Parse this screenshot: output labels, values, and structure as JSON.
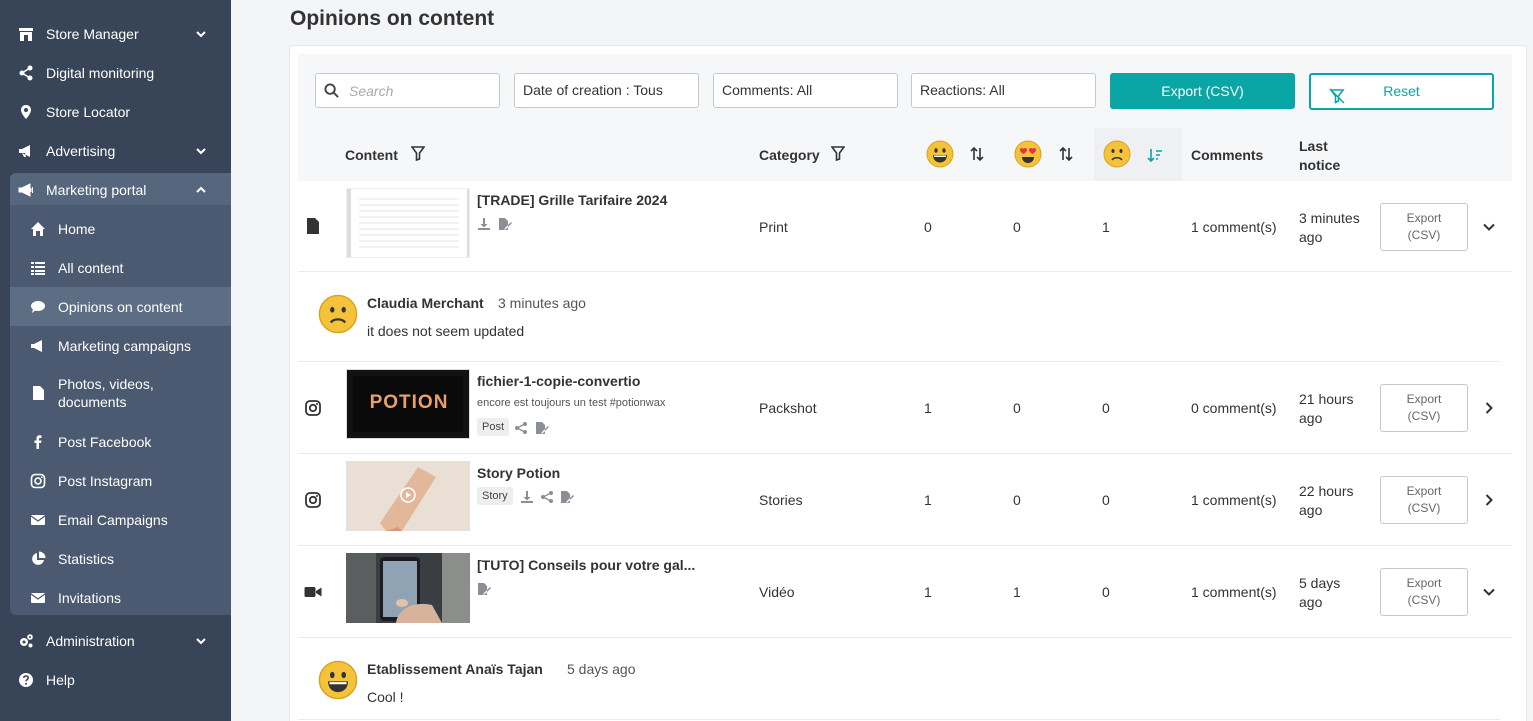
{
  "sidebar": {
    "items": [
      {
        "label": "Store Manager",
        "icon": "store-icon"
      },
      {
        "label": "Digital monitoring",
        "icon": "share-icon"
      },
      {
        "label": "Store Locator",
        "icon": "map-pin-icon"
      },
      {
        "label": "Advertising",
        "icon": "megaphone-icon"
      },
      {
        "label": "Marketing portal",
        "icon": "megaphone-icon"
      },
      {
        "label": "Administration",
        "icon": "gears-icon"
      },
      {
        "label": "Help",
        "icon": "help-icon"
      }
    ],
    "submenu": [
      {
        "label": "Home",
        "icon": "home-icon"
      },
      {
        "label": "All content",
        "icon": "list-icon"
      },
      {
        "label": "Opinions on content",
        "icon": "comment-icon"
      },
      {
        "label": "Marketing campaigns",
        "icon": "megaphone-icon"
      },
      {
        "label": "Photos, videos, documents",
        "icon": "file-icon"
      },
      {
        "label": "Post Facebook",
        "icon": "facebook-icon"
      },
      {
        "label": "Post Instagram",
        "icon": "instagram-icon"
      },
      {
        "label": "Email Campaigns",
        "icon": "envelope-icon"
      },
      {
        "label": "Statistics",
        "icon": "pie-chart-icon"
      },
      {
        "label": "Invitations",
        "icon": "envelope-icon"
      }
    ]
  },
  "page": {
    "title": "Opinions on content"
  },
  "filters": {
    "search_placeholder": "Search",
    "date": "Date of creation : Tous",
    "comments": "Comments: All",
    "reactions": "Reactions:  All",
    "export": "Export (CSV)",
    "reset": "Reset"
  },
  "table": {
    "headers": {
      "content": "Content",
      "category": "Category",
      "comments": "Comments",
      "last_notice": "Last notice"
    },
    "rows": [
      {
        "type_icon": "file-icon",
        "title": "[TRADE] Grille Tarifaire 2024",
        "desc": "",
        "tag": "",
        "category": "Print",
        "r1": "0",
        "r2": "0",
        "r3": "1",
        "comments": "1 comment(s)",
        "last_line1": "3 minutes",
        "last_line2": "ago",
        "export_l1": "Export",
        "export_l2": "(CSV)",
        "expanded": true
      },
      {
        "type_icon": "instagram-icon",
        "title": "fichier-1-copie-convertio",
        "desc": "encore est toujours un test #potionwax",
        "tag": "Post",
        "category": "Packshot",
        "r1": "1",
        "r2": "0",
        "r3": "0",
        "comments": "0 comment(s)",
        "last_line1": "21 hours",
        "last_line2": "ago",
        "export_l1": "Export",
        "export_l2": "(CSV)",
        "expanded": false
      },
      {
        "type_icon": "instagram-icon",
        "title": "Story Potion",
        "desc": "",
        "tag": "Story",
        "category": "Stories",
        "r1": "1",
        "r2": "0",
        "r3": "0",
        "comments": "1 comment(s)",
        "last_line1": "22 hours",
        "last_line2": "ago",
        "export_l1": "Export",
        "export_l2": "(CSV)",
        "expanded": false
      },
      {
        "type_icon": "video-icon",
        "title": "[TUTO] Conseils pour votre gal...",
        "desc": "",
        "tag": "",
        "category": "Vidéo",
        "r1": "1",
        "r2": "1",
        "r3": "0",
        "comments": "1 comment(s)",
        "last_line1": "5 days",
        "last_line2": "ago",
        "export_l1": "Export",
        "export_l2": "(CSV)",
        "expanded": true
      }
    ],
    "thumb_text": "POTION"
  },
  "comments": [
    {
      "author": "Claudia Merchant",
      "time": "3 minutes ago",
      "text": "it does not seem updated",
      "reaction": "frown"
    },
    {
      "author": "Etablissement Anaïs Tajan",
      "time": "5 days ago",
      "text": "Cool !",
      "reaction": "grin"
    }
  ],
  "colors": {
    "sidebar": "#384559",
    "accent": "#0aa5a5",
    "emoji": "#f5c33b"
  }
}
